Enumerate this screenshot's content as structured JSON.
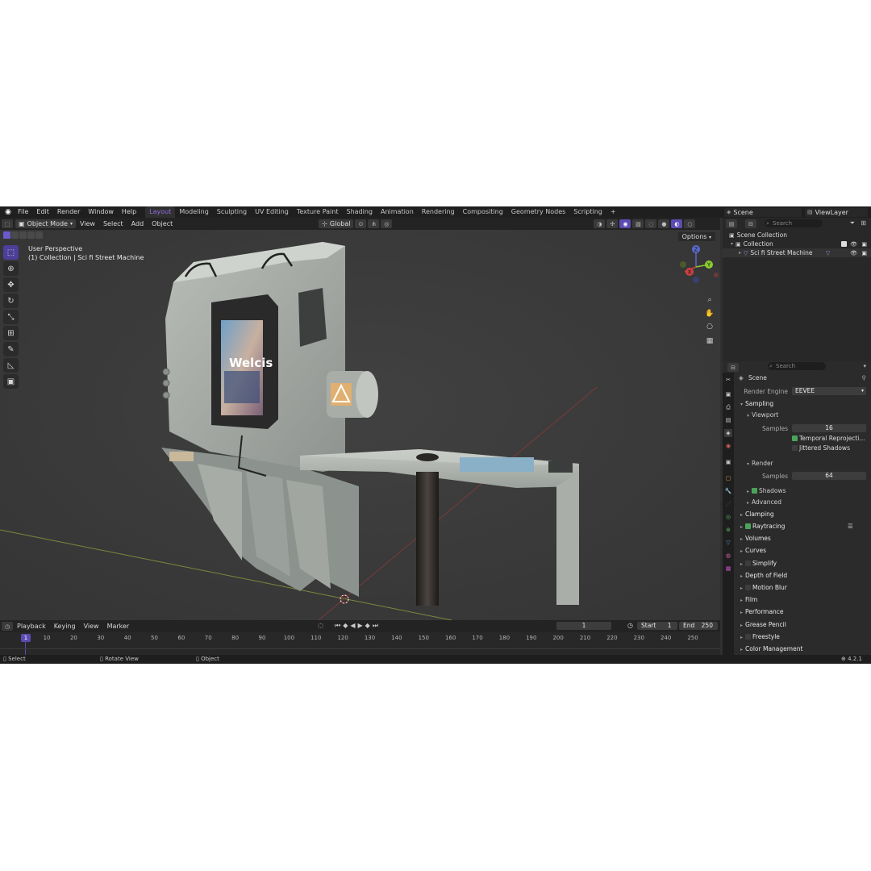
{
  "menu": [
    "File",
    "Edit",
    "Render",
    "Window",
    "Help"
  ],
  "workspaces": [
    {
      "label": "Layout",
      "active": true
    },
    {
      "label": "Modeling"
    },
    {
      "label": "Sculpting"
    },
    {
      "label": "UV Editing"
    },
    {
      "label": "Texture Paint"
    },
    {
      "label": "Shading"
    },
    {
      "label": "Animation"
    },
    {
      "label": "Rendering"
    },
    {
      "label": "Compositing"
    },
    {
      "label": "Geometry Nodes"
    },
    {
      "label": "Scripting"
    }
  ],
  "add_workspace": "+",
  "scene": {
    "name": "Scene",
    "view_layer": "ViewLayer"
  },
  "viewport_header": {
    "mode": "Object Mode",
    "menus": [
      "View",
      "Select",
      "Add",
      "Object"
    ],
    "transform_orientation": "Global",
    "options": "Options"
  },
  "viewport": {
    "perspective": "User Perspective",
    "collection_info": "(1) Collection | Sci fi Street Machine",
    "screen_text": "Welcis"
  },
  "tools": [
    {
      "name": "select-box",
      "icon": "⬚",
      "active": true
    },
    {
      "name": "cursor",
      "icon": "⊕"
    },
    {
      "name": "move",
      "icon": "✥"
    },
    {
      "name": "rotate",
      "icon": "↻"
    },
    {
      "name": "scale",
      "icon": "⤡"
    },
    {
      "name": "transform",
      "icon": "⊞"
    },
    {
      "name": "annotate",
      "icon": "✎"
    },
    {
      "name": "measure",
      "icon": "◺"
    },
    {
      "name": "add-cube",
      "icon": "▣"
    }
  ],
  "gizmo": {
    "z": "Z",
    "x": "X",
    "y": "Y"
  },
  "timeline": {
    "menus": [
      "Playback",
      "Keying",
      "View",
      "Marker"
    ],
    "current_frame": "1",
    "start_label": "Start",
    "start": "1",
    "end_label": "End",
    "end": "250",
    "ticks": [
      "10",
      "20",
      "30",
      "40",
      "50",
      "60",
      "70",
      "80",
      "90",
      "100",
      "110",
      "120",
      "130",
      "140",
      "150",
      "160",
      "170",
      "180",
      "190",
      "200",
      "210",
      "220",
      "230",
      "240",
      "250"
    ]
  },
  "status": {
    "select": "Select",
    "rotate": "Rotate View",
    "object": "Object",
    "version": "4.2.1"
  },
  "outliner": {
    "search_placeholder": "Search",
    "scene_collection": "Scene Collection",
    "collection": "Collection",
    "object": "Sci fi Street Machine"
  },
  "properties": {
    "search_placeholder": "Search",
    "context": "Scene",
    "render_engine_label": "Render Engine",
    "render_engine": "EEVEE",
    "sampling": "Sampling",
    "viewport": "Viewport",
    "samples_label": "Samples",
    "viewport_samples": "16",
    "temporal_reprojection": "Temporal Reprojecti...",
    "jittered_shadows": "Jittered Shadows",
    "render": "Render",
    "render_samples": "64",
    "shadows": "Shadows",
    "advanced": "Advanced",
    "panels": [
      "Clamping",
      "Raytracing",
      "Volumes",
      "Curves",
      "Simplify",
      "Depth of Field",
      "Motion Blur",
      "Film",
      "Performance",
      "Grease Pencil",
      "Freestyle",
      "Color Management"
    ]
  },
  "colors": {
    "accent": "#5b4bb2",
    "workspace_active": "#8f6fe0",
    "check_on": "#4aa35a"
  }
}
